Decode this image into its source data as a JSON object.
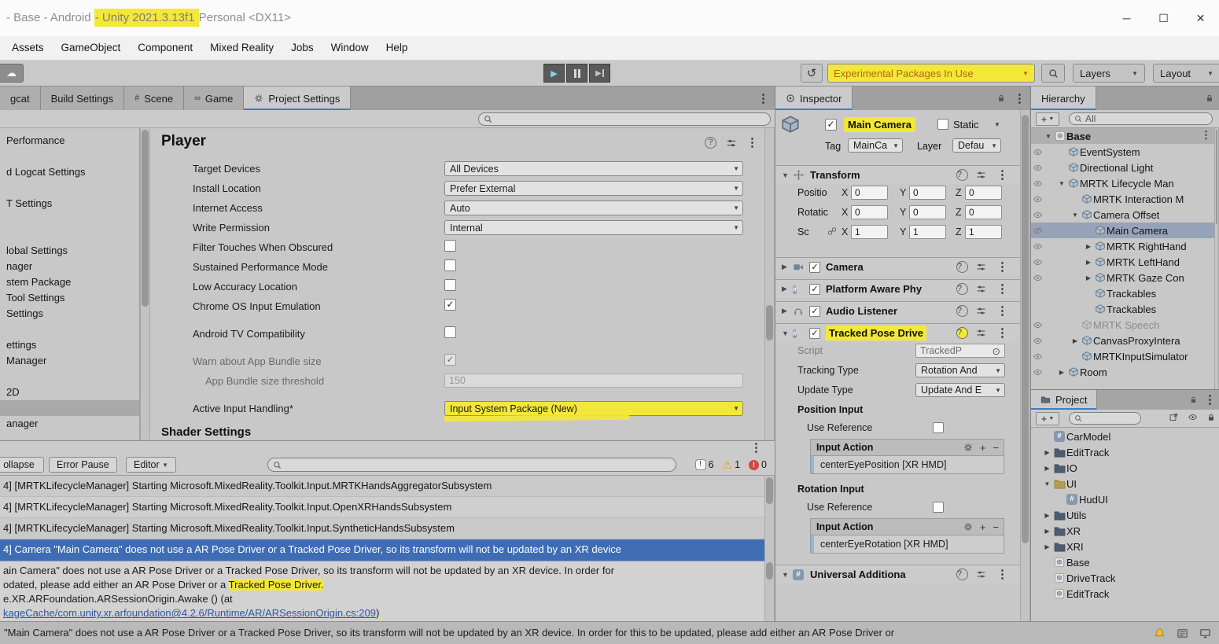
{
  "window": {
    "title_prefix": "- Base - Android ",
    "title_highlight": "- Unity 2021.3.13f1 ",
    "title_suffix": "Personal <DX11>"
  },
  "menu": {
    "items": [
      "Assets",
      "GameObject",
      "Component",
      "Mixed Reality",
      "Jobs",
      "Window",
      "Help"
    ]
  },
  "toolbar": {
    "experimental": "Experimental Packages In Use",
    "layers": "Layers",
    "layout": "Layout"
  },
  "tabs": {
    "left": [
      {
        "label": "gcat",
        "icon": null
      },
      {
        "label": "Build Settings",
        "icon": null
      },
      {
        "label": "Scene",
        "icon": "grid"
      },
      {
        "label": "Game",
        "icon": "game"
      },
      {
        "label": "Project Settings",
        "icon": "gear",
        "active": true
      }
    ],
    "inspector": "Inspector",
    "hierarchy": "Hierarchy",
    "project": "Project"
  },
  "project_settings": {
    "sidebar": [
      {
        "label": "Performance",
        "gap": 0
      },
      {
        "label": "d Logcat Settings",
        "gap": 20
      },
      {
        "label": "T Settings",
        "gap": 20
      },
      {
        "label": "lobal Settings",
        "gap": 40
      },
      {
        "label": "nager",
        "gap": 0
      },
      {
        "label": "stem Package",
        "gap": 0
      },
      {
        "label": "Tool Settings",
        "gap": 0
      },
      {
        "label": "Settings",
        "gap": 0
      },
      {
        "label": "ettings",
        "gap": 20
      },
      {
        "label": "Manager",
        "gap": 0
      },
      {
        "label": "2D",
        "gap": 20
      },
      {
        "label": "",
        "gap": 0,
        "selected": true
      },
      {
        "label": "anager",
        "gap": 0
      }
    ],
    "player": {
      "title": "Player",
      "rows": [
        {
          "label": "Target Devices",
          "type": "dropdown",
          "value": "All Devices",
          "gap": 0
        },
        {
          "label": "Install Location",
          "type": "dropdown",
          "value": "Prefer External",
          "gap": 0
        },
        {
          "label": "Internet Access",
          "type": "dropdown",
          "value": "Auto",
          "gap": 0
        },
        {
          "label": "Write Permission",
          "type": "dropdown",
          "value": "Internal",
          "gap": 0
        },
        {
          "label": "Filter Touches When Obscured",
          "type": "checkbox",
          "checked": false,
          "gap": 0
        },
        {
          "label": "Sustained Performance Mode",
          "type": "checkbox",
          "checked": false,
          "gap": 0
        },
        {
          "label": "Low Accuracy Location",
          "type": "checkbox",
          "checked": false,
          "gap": 0
        },
        {
          "label": "Chrome OS Input Emulation",
          "type": "checkbox",
          "checked": true,
          "gap": 0
        },
        {
          "label": "Android TV Compatibility",
          "type": "checkbox",
          "checked": false,
          "gap": 10
        },
        {
          "label": "Warn about App Bundle size",
          "type": "checkbox",
          "checked": true,
          "disabled": true,
          "gap": 10
        },
        {
          "label": "App Bundle size threshold",
          "type": "textfield",
          "value": "150",
          "disabled": true,
          "indent": true,
          "gap": 0
        },
        {
          "label": "Active Input Handling*",
          "type": "dropdown",
          "value": "Input System Package (New)",
          "highlight": true,
          "gap": 10
        }
      ],
      "section_footer": "Shader Settings"
    }
  },
  "console": {
    "collapse_button": "ollapse",
    "error_pause_button": "Error Pause",
    "editor_dropdown": "Editor",
    "counts": {
      "info": "6",
      "warning": "1",
      "error": "0"
    },
    "logs": [
      {
        "text": "4] [MRTKLifecycleManager] Starting Microsoft.MixedReality.Toolkit.Input.MRTKHandsAggregatorSubsystem",
        "selected": false
      },
      {
        "text": "4] [MRTKLifecycleManager] Starting Microsoft.MixedReality.Toolkit.Input.OpenXRHandsSubsystem",
        "selected": false
      },
      {
        "text": "4] [MRTKLifecycleManager] Starting Microsoft.MixedReality.Toolkit.Input.SyntheticHandsSubsystem",
        "selected": false
      },
      {
        "text": "4] Camera \"Main Camera\" does not use a AR Pose Driver or a Tracked Pose Driver, so its transform will not be updated by an XR device",
        "selected": true
      }
    ],
    "detail": {
      "line1": "ain Camera\" does not use a AR Pose Driver or a Tracked Pose Driver, so its transform will not be updated by an XR device.  In order for",
      "line2_pre": "odated, please add either an AR Pose Driver or a ",
      "line2_highlight": "Tracked Pose Driver.",
      "line3": "e.XR.ARFoundation.ARSessionOrigin.Awake () (at",
      "line4_link": "kageCache/com.unity.xr.arfoundation@4.2.6/Runtime/AR/ARSessionOrigin.cs:209",
      "line4_suffix": ")"
    }
  },
  "status_bar": {
    "message": "\"Main Camera\" does not use a AR Pose Driver or a Tracked Pose Driver, so its transform will not be updated by an XR device.  In order for this to be updated, please add either an AR Pose Driver or"
  },
  "inspector": {
    "header": {
      "name": "Main Camera",
      "static_label": "Static",
      "tag_label": "Tag",
      "tag_value": "MainCa",
      "layer_label": "Layer",
      "layer_value": "Defau"
    },
    "transform": {
      "title": "Transform",
      "axis": [
        "X",
        "Y",
        "Z"
      ],
      "rows": [
        {
          "label": "Positio",
          "x": "0",
          "y": "0",
          "z": "0",
          "link": false
        },
        {
          "label": "Rotatic",
          "x": "0",
          "y": "0",
          "z": "0",
          "link": false
        },
        {
          "label": "Sc",
          "x": "1",
          "y": "1",
          "z": "1",
          "link": true
        }
      ]
    },
    "components": [
      {
        "title": "Camera"
      },
      {
        "title": "Platform Aware Phy"
      },
      {
        "title": "Audio Listener"
      },
      {
        "title": "Tracked Pose Drive"
      }
    ],
    "tracked_pose": {
      "script_label": "Script",
      "script_value": "TrackedP",
      "fields": [
        {
          "label": "Tracking Type",
          "value": "Rotation And"
        },
        {
          "label": "Update Type",
          "value": "Update And E"
        }
      ],
      "position_header": "Position Input",
      "use_reference_label": "Use Reference",
      "input_action_label": "Input Action",
      "position_binding": "centerEyePosition [XR HMD]",
      "rotation_header": "Rotation Input",
      "rotation_binding": "centerEyeRotation [XR HMD]"
    },
    "universal": {
      "title": "Universal Additiona"
    }
  },
  "hierarchy": {
    "search_value": "All",
    "items": [
      {
        "label": "Base",
        "depth": 0,
        "icon": "scene",
        "arrow": "down",
        "header": true
      },
      {
        "label": "EventSystem",
        "depth": 1,
        "icon": "cube",
        "eye": true
      },
      {
        "label": "Directional Light",
        "depth": 1,
        "icon": "cube",
        "eye": true
      },
      {
        "label": "MRTK Lifecycle Man",
        "depth": 1,
        "icon": "cube",
        "arrow": "down",
        "eye": true
      },
      {
        "label": "MRTK Interaction M",
        "depth": 2,
        "icon": "cube",
        "eye": true
      },
      {
        "label": "Camera Offset",
        "depth": 2,
        "icon": "cube",
        "arrow": "down",
        "eye": true
      },
      {
        "label": "Main Camera",
        "depth": 3,
        "icon": "cube",
        "selected": true,
        "eye_off": true
      },
      {
        "label": "MRTK RightHand",
        "depth": 3,
        "icon": "cube",
        "arrow": "right",
        "eye": true
      },
      {
        "label": "MRTK LeftHand",
        "depth": 3,
        "icon": "cube",
        "arrow": "right",
        "eye": true
      },
      {
        "label": "MRTK Gaze Con",
        "depth": 3,
        "icon": "cube",
        "arrow": "right",
        "eye": true
      },
      {
        "label": "Trackables",
        "depth": 3,
        "icon": "cube"
      },
      {
        "label": "Trackables",
        "depth": 3,
        "icon": "cube"
      },
      {
        "label": "MRTK Speech",
        "depth": 2,
        "icon": "cube",
        "disabled": true,
        "eye": true
      },
      {
        "label": "CanvasProxyIntera",
        "depth": 2,
        "icon": "cube",
        "arrow": "right",
        "eye": true
      },
      {
        "label": "MRTKInputSimulator",
        "depth": 2,
        "icon": "cube",
        "eye": true
      },
      {
        "label": "Room",
        "depth": 1,
        "icon": "cube",
        "arrow": "right",
        "eye": true
      }
    ]
  },
  "project": {
    "items": [
      {
        "label": "CarModel",
        "depth": 1,
        "icon": "script"
      },
      {
        "label": "EditTrack",
        "depth": 1,
        "icon": "folder",
        "arrow": "right"
      },
      {
        "label": "IO",
        "depth": 1,
        "icon": "folder",
        "arrow": "right"
      },
      {
        "label": "UI",
        "depth": 1,
        "icon": "folder-open",
        "arrow": "down"
      },
      {
        "label": "HudUI",
        "depth": 2,
        "icon": "script"
      },
      {
        "label": "Utils",
        "depth": 1,
        "icon": "folder",
        "arrow": "right"
      },
      {
        "label": "XR",
        "depth": 1,
        "icon": "folder",
        "arrow": "right"
      },
      {
        "label": "XRI",
        "depth": 1,
        "icon": "folder",
        "arrow": "right"
      },
      {
        "label": "Base",
        "depth": 1,
        "icon": "scene"
      },
      {
        "label": "DriveTrack",
        "depth": 1,
        "icon": "scene"
      },
      {
        "label": "EditTrack",
        "depth": 1,
        "icon": "scene"
      }
    ]
  }
}
